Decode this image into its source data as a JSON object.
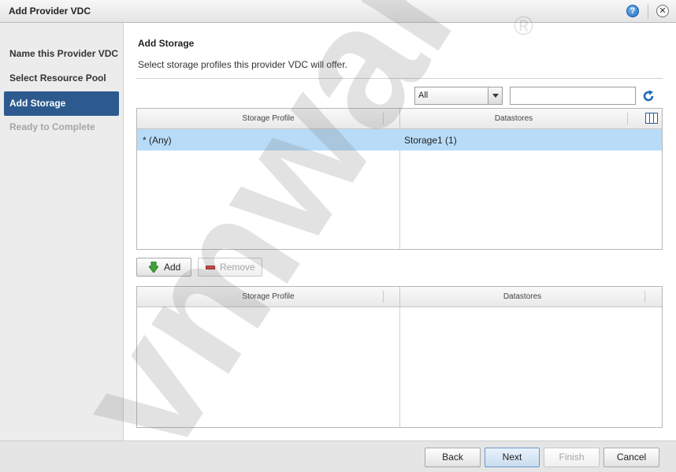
{
  "window": {
    "title": "Add Provider VDC",
    "help_icon": "?",
    "close_icon": "✕"
  },
  "sidebar": {
    "items": [
      {
        "label": "Name this Provider VDC",
        "state": "normal"
      },
      {
        "label": "Select Resource Pool",
        "state": "normal"
      },
      {
        "label": "Add Storage",
        "state": "active"
      },
      {
        "label": "Ready to Complete",
        "state": "disabled"
      }
    ]
  },
  "main": {
    "title": "Add Storage",
    "description": "Select storage profiles this provider VDC will offer.",
    "filter": {
      "selected": "All"
    },
    "search": {
      "value": "",
      "placeholder": ""
    },
    "top_grid": {
      "columns": [
        "Storage Profile",
        "Datastores"
      ],
      "rows": [
        {
          "storage_profile": "* (Any)",
          "datastores": "Storage1 (1)",
          "selected": true
        }
      ]
    },
    "buttons": {
      "add": "Add",
      "remove": "Remove"
    },
    "bottom_grid": {
      "columns": [
        "Storage Profile",
        "Datastores"
      ],
      "rows": []
    }
  },
  "footer": {
    "back": "Back",
    "next": "Next",
    "finish": "Finish",
    "cancel": "Cancel"
  },
  "watermark": {
    "text": "vmware",
    "mark": "®"
  },
  "colors": {
    "active_nav": "#2d5a8e",
    "selected_row": "#b8dcf8",
    "accent_blue": "#1e6bc0"
  }
}
